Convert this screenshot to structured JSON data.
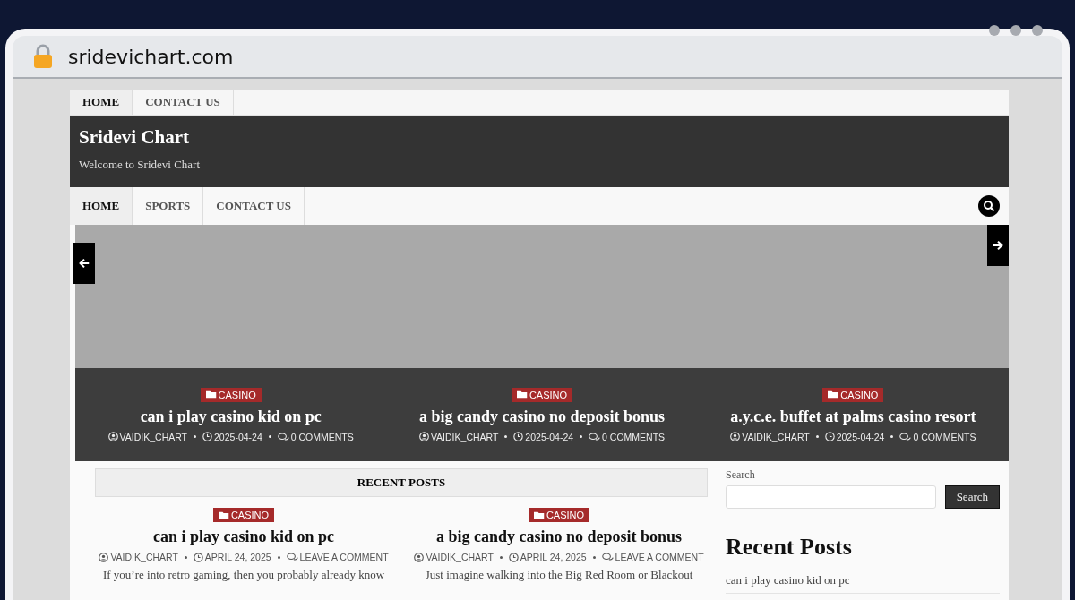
{
  "browser": {
    "url": "sridevichart.com"
  },
  "top_menu": [
    {
      "label": "HOME",
      "selected": true
    },
    {
      "label": "CONTACT US",
      "selected": false
    }
  ],
  "site": {
    "title": "Sridevi Chart",
    "tagline": "Welcome to Sridevi Chart"
  },
  "main_menu": [
    {
      "label": "HOME",
      "selected": true
    },
    {
      "label": "SPORTS",
      "selected": false
    },
    {
      "label": "CONTACT US",
      "selected": false
    }
  ],
  "slider": {
    "slides": [
      {
        "category": "CASINO",
        "title": "can i play casino kid on pc",
        "author": "VAIDIK_CHART",
        "date": "2025-04-24",
        "comments": "0 COMMENTS"
      },
      {
        "category": "CASINO",
        "title": "a big candy casino no deposit bonus",
        "author": "VAIDIK_CHART",
        "date": "2025-04-24",
        "comments": "0 COMMENTS"
      },
      {
        "category": "CASINO",
        "title": "a.y.c.e. buffet at palms casino resort",
        "author": "VAIDIK_CHART",
        "date": "2025-04-24",
        "comments": "0 COMMENTS"
      }
    ]
  },
  "recent_posts": {
    "heading": "RECENT POSTS",
    "posts": [
      {
        "category": "CASINO",
        "title": "can i play casino kid on pc",
        "author": "VAIDIK_CHART",
        "date": "APRIL 24, 2025",
        "comments": "LEAVE A COMMENT",
        "excerpt": "If you’re into retro gaming, then you probably already know"
      },
      {
        "category": "CASINO",
        "title": "a big candy casino no deposit bonus",
        "author": "VAIDIK_CHART",
        "date": "APRIL 24, 2025",
        "comments": "LEAVE A COMMENT",
        "excerpt": "Just imagine walking into the Big Red Room or Blackout"
      }
    ]
  },
  "sidebar": {
    "search_label": "Search",
    "search_button": "Search",
    "recent_heading": "Recent Posts",
    "recent_items": [
      "can i play casino kid on pc"
    ]
  }
}
